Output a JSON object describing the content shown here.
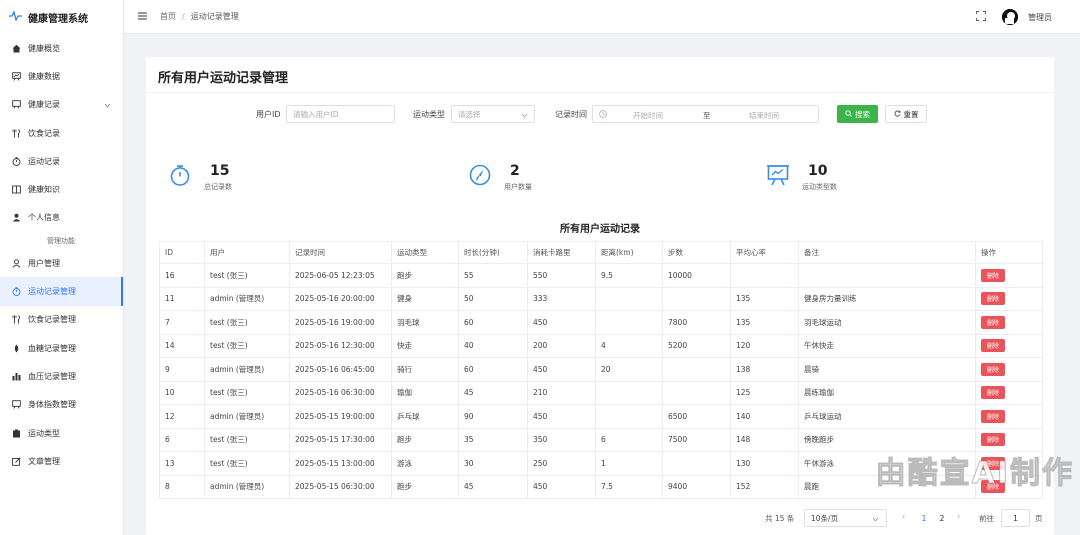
{
  "app": {
    "title": "健康管理系统"
  },
  "sidebar": {
    "items": [
      {
        "label": "健康概览",
        "icon": "home-icon"
      },
      {
        "label": "健康数据",
        "icon": "chart-board-icon"
      },
      {
        "label": "健康记录",
        "icon": "chart-board-icon",
        "has_submenu": true
      },
      {
        "label": "饮食记录",
        "icon": "fork-knife-icon"
      },
      {
        "label": "运动记录",
        "icon": "stopwatch-icon"
      },
      {
        "label": "健康知识",
        "icon": "book-icon"
      },
      {
        "label": "个人信息",
        "icon": "user-icon"
      }
    ],
    "group_label": "管理功能",
    "admin_items": [
      {
        "label": "用户管理",
        "icon": "user-outline-icon"
      },
      {
        "label": "运动记录管理",
        "icon": "stopwatch-icon",
        "active": true
      },
      {
        "label": "饮食记录管理",
        "icon": "fork-knife-icon"
      },
      {
        "label": "血糖记录管理",
        "icon": "drop-icon"
      },
      {
        "label": "血压记录管理",
        "icon": "bar-chart-icon"
      },
      {
        "label": "身体指数管理",
        "icon": "chart-board-icon"
      },
      {
        "label": "运动类型",
        "icon": "clipboard-icon"
      },
      {
        "label": "文章管理",
        "icon": "edit-icon"
      }
    ]
  },
  "header": {
    "breadcrumb": [
      "首页",
      "运动记录管理"
    ],
    "username": "管理员"
  },
  "page": {
    "title": "所有用户运动记录管理"
  },
  "filter": {
    "user_id_label": "用户ID",
    "user_id_placeholder": "请输入用户ID",
    "type_label": "运动类型",
    "type_placeholder": "请选择",
    "time_label": "记录时间",
    "start_placeholder": "开始时间",
    "range_sep": "至",
    "end_placeholder": "结束时间",
    "search_label": "搜索",
    "reset_label": "重置"
  },
  "stats": [
    {
      "value": "15",
      "label": "总记录数",
      "icon": "stopwatch-icon"
    },
    {
      "value": "2",
      "label": "用户数量",
      "icon": "compass-icon"
    },
    {
      "value": "10",
      "label": "运动类型数",
      "icon": "presentation-icon"
    }
  ],
  "table": {
    "title": "所有用户运动记录",
    "columns": [
      "ID",
      "用户",
      "记录时间",
      "运动类型",
      "时长(分钟)",
      "消耗卡路里",
      "距离(km)",
      "步数",
      "平均心率",
      "备注",
      "操作"
    ],
    "delete_label": "删除",
    "rows": [
      [
        "16",
        "test (张三)",
        "2025-06-05 12:23:05",
        "跑步",
        "55",
        "550",
        "9.5",
        "10000",
        "",
        ""
      ],
      [
        "11",
        "admin (管理员)",
        "2025-05-16 20:00:00",
        "健身",
        "50",
        "333",
        "",
        "",
        "135",
        "健身房力量训练"
      ],
      [
        "7",
        "test (张三)",
        "2025-05-16 19:00:00",
        "羽毛球",
        "60",
        "450",
        "",
        "7800",
        "135",
        "羽毛球运动"
      ],
      [
        "14",
        "test (张三)",
        "2025-05-16 12:30:00",
        "快走",
        "40",
        "200",
        "4",
        "5200",
        "120",
        "午休快走"
      ],
      [
        "9",
        "admin (管理员)",
        "2025-05-16 06:45:00",
        "骑行",
        "60",
        "450",
        "20",
        "",
        "138",
        "晨骑"
      ],
      [
        "10",
        "test (张三)",
        "2025-05-16 06:30:00",
        "瑜伽",
        "45",
        "210",
        "",
        "",
        "125",
        "晨练瑜伽"
      ],
      [
        "12",
        "admin (管理员)",
        "2025-05-15 19:00:00",
        "乒乓球",
        "90",
        "450",
        "",
        "6500",
        "140",
        "乒乓球运动"
      ],
      [
        "6",
        "test (张三)",
        "2025-05-15 17:30:00",
        "跑步",
        "35",
        "350",
        "6",
        "7500",
        "148",
        "傍晚跑步"
      ],
      [
        "13",
        "test (张三)",
        "2025-05-15 13:00:00",
        "游泳",
        "30",
        "250",
        "1",
        "",
        "130",
        "午休游泳"
      ],
      [
        "8",
        "admin (管理员)",
        "2025-05-15 06:30:00",
        "跑步",
        "45",
        "450",
        "7.5",
        "9400",
        "152",
        "晨跑"
      ]
    ]
  },
  "pagination": {
    "total_text": "共 15 条",
    "page_size": "10条/页",
    "pages": [
      "1",
      "2"
    ],
    "current_page": "1",
    "goto_label": "前往",
    "goto_value": "1",
    "page_unit": "页"
  },
  "watermark": "由酷宣AI制作",
  "colors": {
    "accent": "#2f7cf6",
    "search_button": "#3cb44b",
    "delete_button": "#e9535a",
    "stat_icon": "#3a8ee6"
  }
}
